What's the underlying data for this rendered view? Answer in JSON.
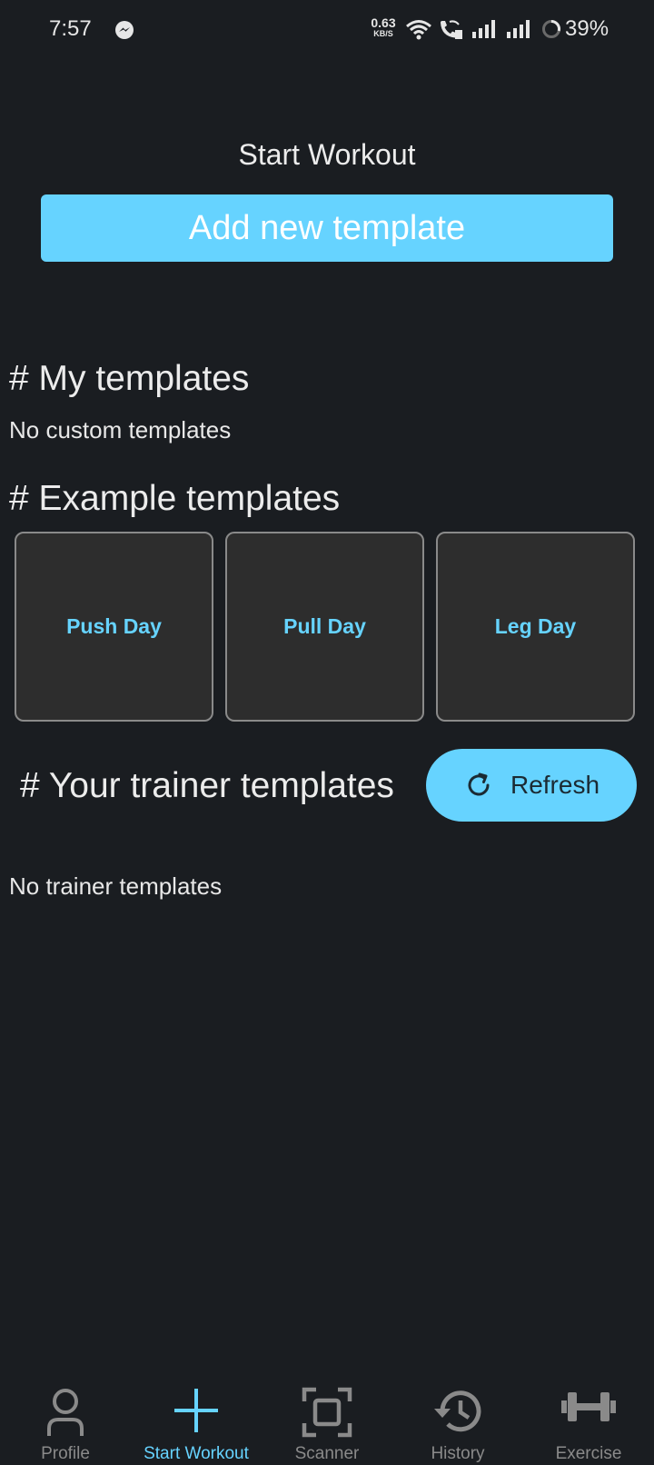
{
  "status_bar": {
    "time": "7:57",
    "net_speed_value": "0.63",
    "net_speed_unit": "KB/S",
    "battery": "39%",
    "icons": [
      "messenger-icon",
      "wifi-icon",
      "wifi-call-icon",
      "signal-icon",
      "signal-icon",
      "battery-ring-icon"
    ]
  },
  "header": {
    "title": "Start Workout",
    "add_button_label": "Add new template"
  },
  "my_templates": {
    "heading": "# My templates",
    "empty_text": "No custom templates"
  },
  "example_templates": {
    "heading": "# Example templates",
    "items": [
      {
        "label": "Push Day"
      },
      {
        "label": "Pull Day"
      },
      {
        "label": "Leg Day"
      }
    ]
  },
  "trainer_templates": {
    "heading": "# Your trainer templates",
    "refresh_label": "Refresh",
    "empty_text": "No trainer templates"
  },
  "bottom_nav": {
    "items": [
      {
        "label": "Profile",
        "icon": "person-icon"
      },
      {
        "label": "Start Workout",
        "icon": "plus-icon",
        "active": true
      },
      {
        "label": "Scanner",
        "icon": "scanner-icon"
      },
      {
        "label": "History",
        "icon": "history-icon"
      },
      {
        "label": "Exercise",
        "icon": "dumbbell-icon"
      }
    ]
  },
  "colors": {
    "background": "#1a1d21",
    "accent": "#66d3ff",
    "card": "#2d2d2d",
    "inactive_nav": "#8a8a8a"
  }
}
